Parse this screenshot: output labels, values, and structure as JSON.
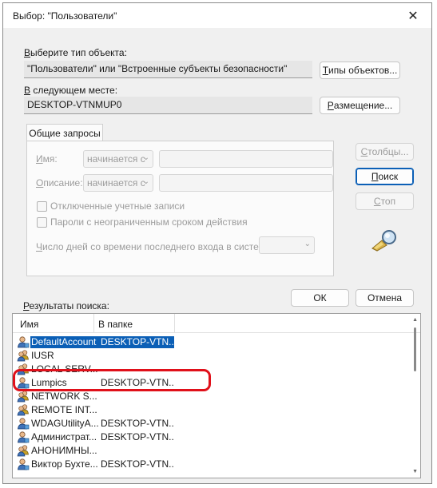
{
  "window": {
    "title": "Выбор: \"Пользователи\""
  },
  "object_type": {
    "label_prefix": "В",
    "label_rest": "ыберите тип объекта:",
    "value": "\"Пользователи\" или \"Встроенные субъекты безопасности\"",
    "button_prefix": "Т",
    "button_rest": "ипы объектов..."
  },
  "location": {
    "label_prefix": "В",
    "label_rest": " следующем месте:",
    "value": "DESKTOP-VTNMUP0",
    "button_prefix": "Р",
    "button_rest": "азмещение..."
  },
  "common_queries": {
    "tab_label": "Общие запросы",
    "name_label_prefix": "И",
    "name_label_rest": "мя:",
    "name_combo": "начинается с",
    "desc_label_prefix": "О",
    "desc_label_rest": "писание:",
    "desc_combo": "начинается с",
    "disabled_accounts_prefix": "О",
    "disabled_accounts_rest": "тключенные учетные записи",
    "nonexpiring_prefix": "П",
    "nonexpiring_rest": "ароли с неограниченным сроком действия",
    "days_label_prefix": "Ч",
    "days_label_rest": "исло дней со времени последнего входа в систему:"
  },
  "actions": {
    "columns_prefix": "С",
    "columns_rest": "толбцы...",
    "search_prefix": "П",
    "search_rest": "оиск",
    "stop_prefix": "С",
    "stop_rest": "топ"
  },
  "footer": {
    "results_label_prefix": "Р",
    "results_label_rest": "езультаты поиска:",
    "ok": "ОК",
    "cancel": "Отмена"
  },
  "results": {
    "columns": [
      "Имя",
      "В папке"
    ],
    "rows": [
      {
        "name": "DefaultAccount",
        "folder": "DESKTOP-VTN...",
        "icon": "user-icon"
      },
      {
        "name": "IUSR",
        "folder": "",
        "icon": "group-icon"
      },
      {
        "name": "LOCAL SERV...",
        "folder": "",
        "icon": "group-icon"
      },
      {
        "name": "Lumpics",
        "folder": "DESKTOP-VTN...",
        "icon": "user-icon"
      },
      {
        "name": "NETWORK S...",
        "folder": "",
        "icon": "group-icon"
      },
      {
        "name": "REMOTE INT...",
        "folder": "",
        "icon": "group-icon"
      },
      {
        "name": "WDAGUtilityA...",
        "folder": "DESKTOP-VTN...",
        "icon": "user-icon"
      },
      {
        "name": "Администрат...",
        "folder": "DESKTOP-VTN...",
        "icon": "user-icon"
      },
      {
        "name": "АНОНИМНЫ...",
        "folder": "",
        "icon": "group-icon"
      },
      {
        "name": "Виктор Бухте...",
        "folder": "DESKTOP-VTN...",
        "icon": "user-icon"
      }
    ],
    "selected_index": 0,
    "highlighted_index": 3
  }
}
